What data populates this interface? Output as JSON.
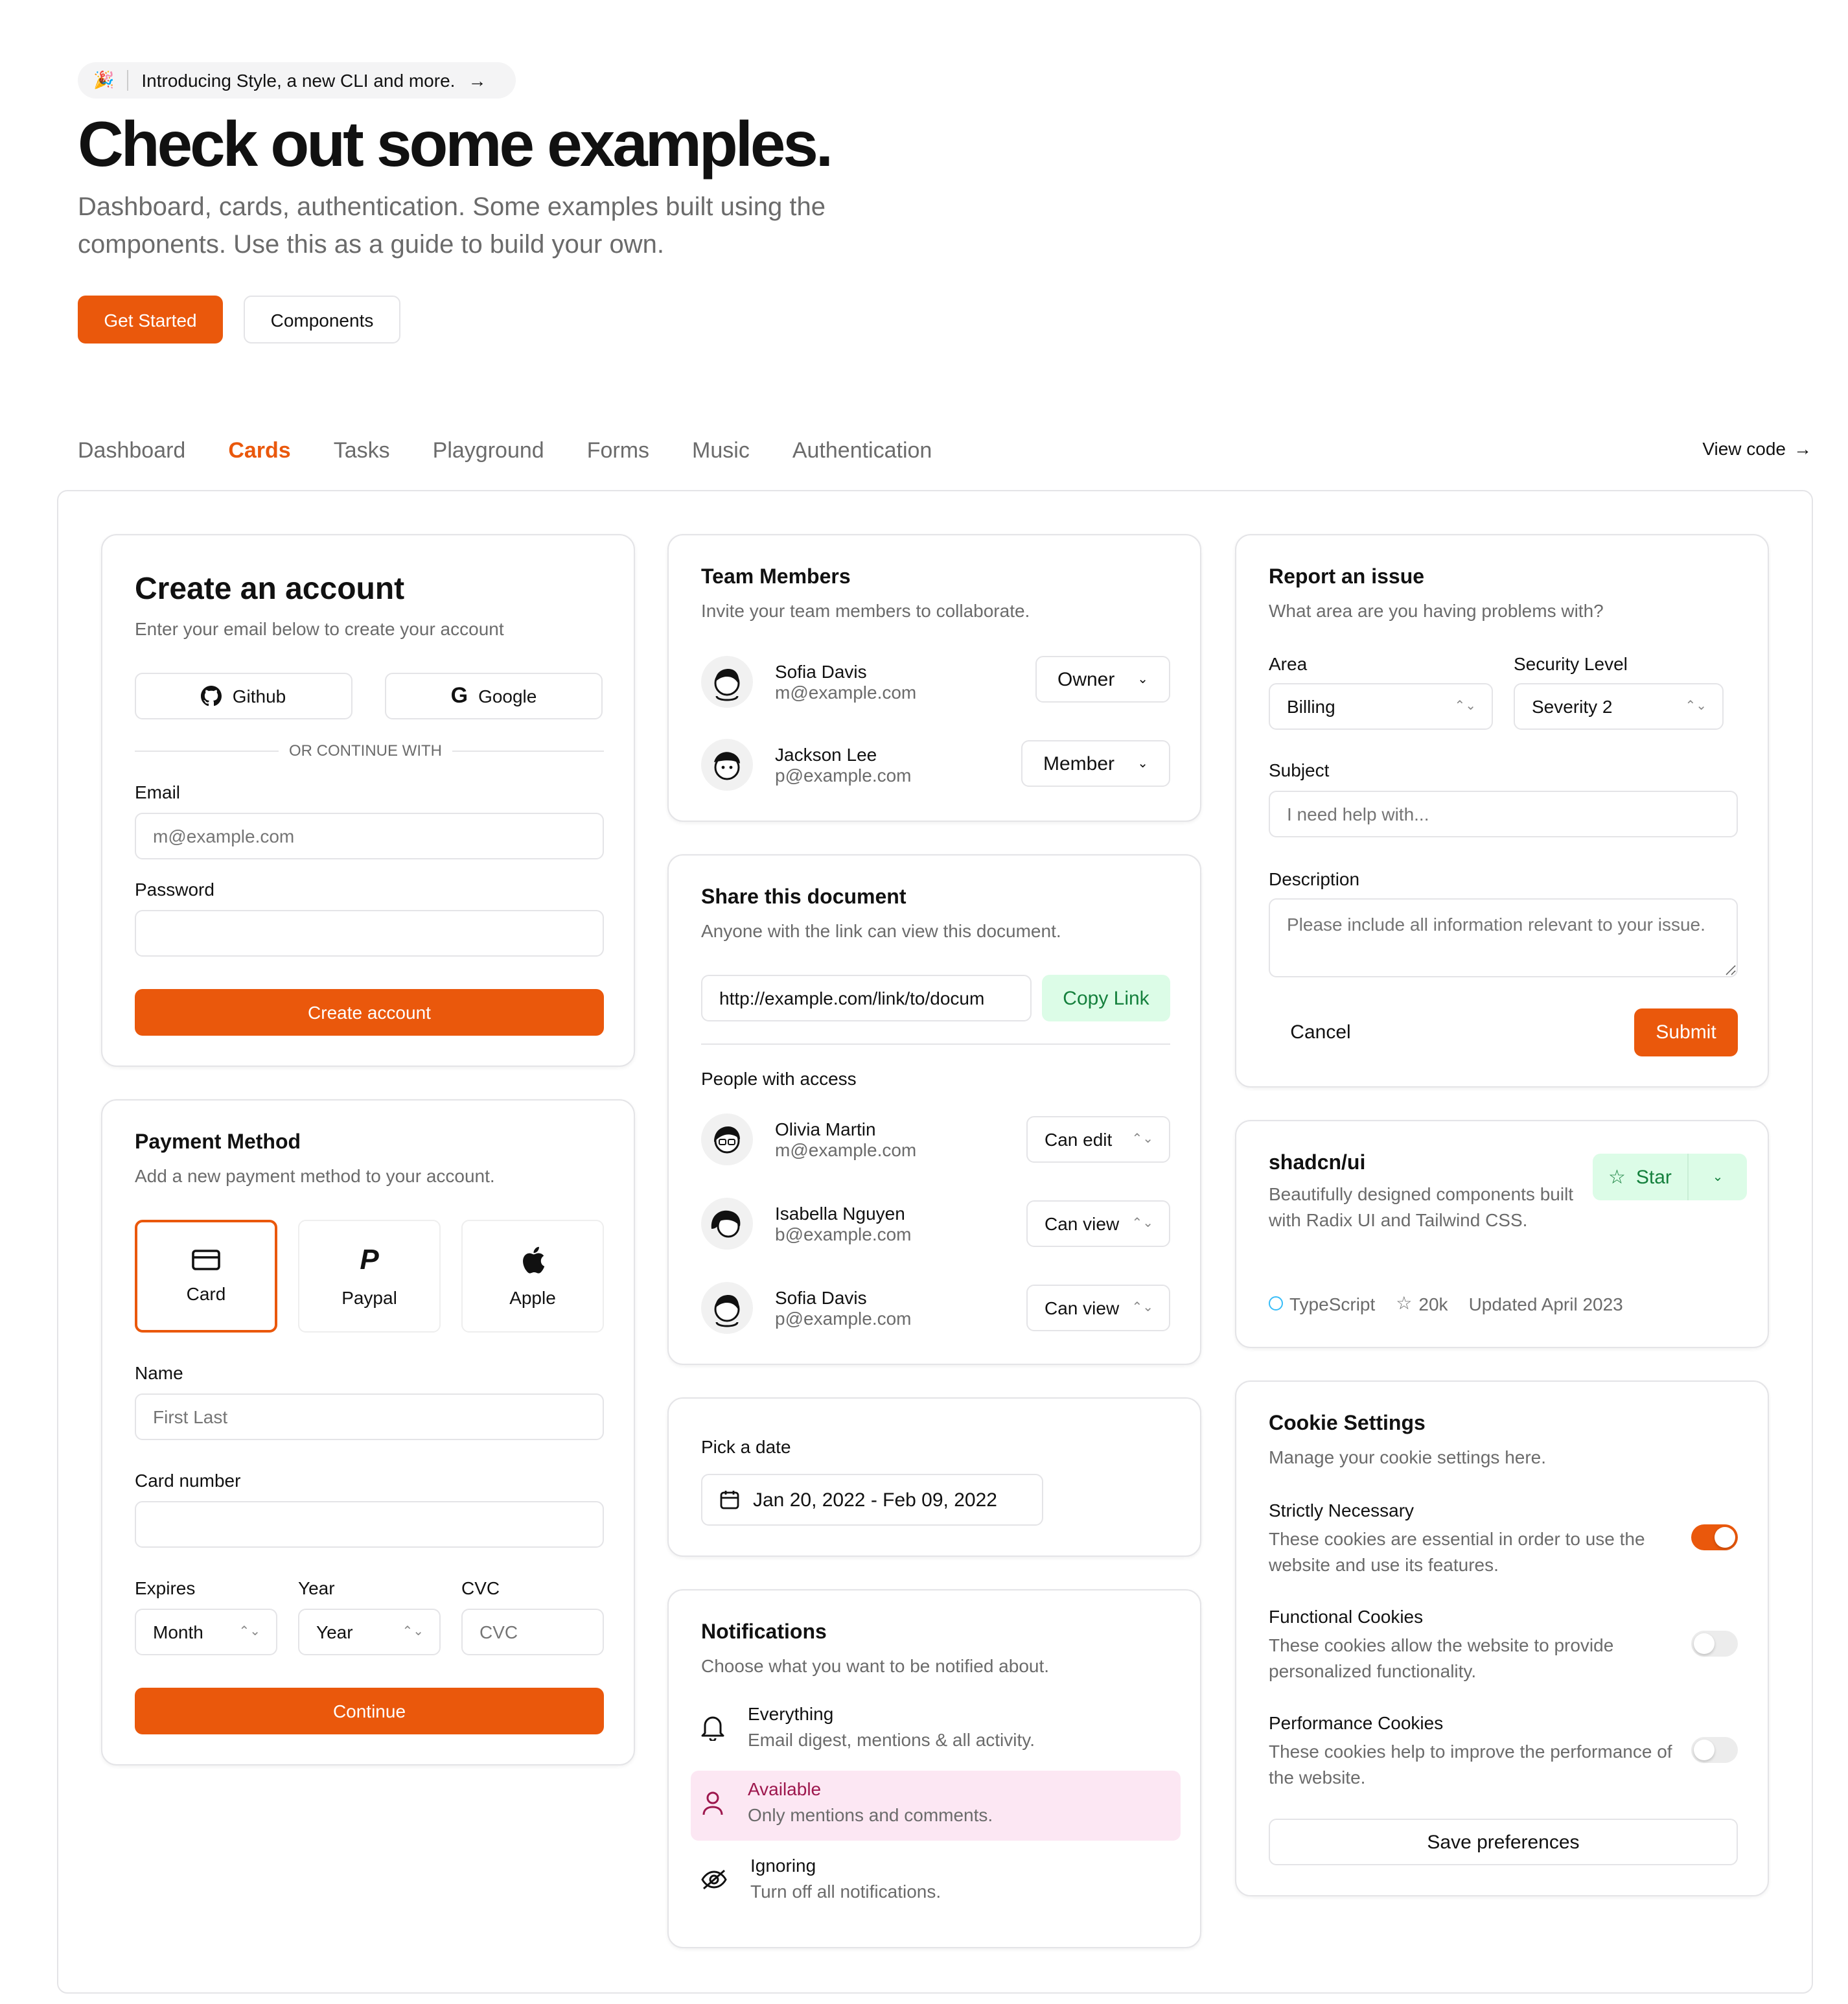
{
  "announcement": {
    "emoji": "🎉",
    "text": "Introducing Style, a new CLI and more."
  },
  "hero": {
    "title": "Check out some examples.",
    "subtitle": "Dashboard, cards, authentication. Some examples built using the components. Use this as a guide to build your own.",
    "primary_button": "Get Started",
    "secondary_button": "Components"
  },
  "tabs": [
    "Dashboard",
    "Cards",
    "Tasks",
    "Playground",
    "Forms",
    "Music",
    "Authentication"
  ],
  "active_tab": "Cards",
  "view_code": "View code",
  "account": {
    "title": "Create an account",
    "description": "Enter your email below to create your account",
    "github": "Github",
    "google": "Google",
    "divider": "OR CONTINUE WITH",
    "email_label": "Email",
    "email_placeholder": "m@example.com",
    "password_label": "Password",
    "submit": "Create account"
  },
  "payment": {
    "title": "Payment Method",
    "description": "Add a new payment method to your account.",
    "methods": [
      "Card",
      "Paypal",
      "Apple"
    ],
    "selected": "Card",
    "name_label": "Name",
    "name_placeholder": "First Last",
    "card_label": "Card number",
    "expires_label": "Expires",
    "year_label": "Year",
    "cvc_label": "CVC",
    "month_value": "Month",
    "year_value": "Year",
    "cvc_placeholder": "CVC",
    "submit": "Continue"
  },
  "team": {
    "title": "Team Members",
    "description": "Invite your team members to collaborate.",
    "members": [
      {
        "name": "Sofia Davis",
        "email": "m@example.com",
        "role": "Owner"
      },
      {
        "name": "Jackson Lee",
        "email": "p@example.com",
        "role": "Member"
      }
    ]
  },
  "share": {
    "title": "Share this document",
    "description": "Anyone with the link can view this document.",
    "link": "http://example.com/link/to/docum",
    "copy": "Copy Link",
    "people_label": "People with access",
    "people": [
      {
        "name": "Olivia Martin",
        "email": "m@example.com",
        "access": "Can edit"
      },
      {
        "name": "Isabella Nguyen",
        "email": "b@example.com",
        "access": "Can view"
      },
      {
        "name": "Sofia Davis",
        "email": "p@example.com",
        "access": "Can view"
      }
    ]
  },
  "date": {
    "label": "Pick a date",
    "range": "Jan 20, 2022 - Feb 09, 2022"
  },
  "notifications": {
    "title": "Notifications",
    "description": "Choose what you want to be notified about.",
    "options": [
      {
        "title": "Everything",
        "desc": "Email digest, mentions & all activity."
      },
      {
        "title": "Available",
        "desc": "Only mentions and comments."
      },
      {
        "title": "Ignoring",
        "desc": "Turn off all notifications."
      }
    ],
    "selected": "Available"
  },
  "issue": {
    "title": "Report an issue",
    "description": "What area are you having problems with?",
    "area_label": "Area",
    "area_value": "Billing",
    "security_label": "Security Level",
    "security_value": "Severity 2",
    "subject_label": "Subject",
    "subject_placeholder": "I need help with...",
    "desc_label": "Description",
    "desc_placeholder": "Please include all information relevant to your issue.",
    "cancel": "Cancel",
    "submit": "Submit"
  },
  "repo": {
    "name": "shadcn/ui",
    "description": "Beautifully designed components built with Radix UI and Tailwind CSS.",
    "star": "Star",
    "language": "TypeScript",
    "stars": "20k",
    "updated": "Updated April 2023"
  },
  "cookies": {
    "title": "Cookie Settings",
    "description": "Manage your cookie settings here.",
    "items": [
      {
        "title": "Strictly Necessary",
        "desc": "These cookies are essential in order to use the website and use its features.",
        "on": true
      },
      {
        "title": "Functional Cookies",
        "desc": "These cookies allow the website to provide personalized functionality.",
        "on": false
      },
      {
        "title": "Performance Cookies",
        "desc": "These cookies help to improve the performance of the website.",
        "on": false
      }
    ],
    "save": "Save preferences"
  },
  "colors": {
    "accent": "#ea580c",
    "accent_light": "#dcfce7",
    "selected_row": "#fce7f3"
  }
}
